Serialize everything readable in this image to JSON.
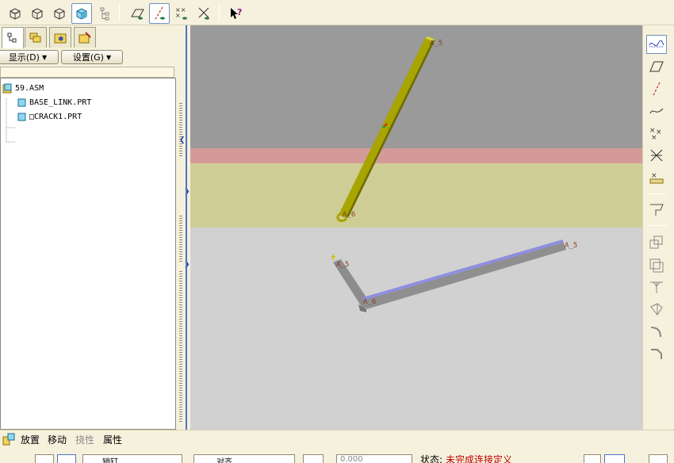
{
  "colors": {
    "app_bg": "#f5f1dc",
    "viewport_top": "#9a9a9a",
    "viewport_bottom": "#d1d1d1",
    "band_red": "#d49a9a",
    "band_yellow": "#cfcd96",
    "active_link": "#a8a400",
    "inactive_link": "#9a9a9a",
    "highlight_edge": "#8f8fe0",
    "accent_blue": "#4f72c6",
    "status_red": "#c00000"
  },
  "toolbar": {
    "icons": [
      "shaded-cube-icon",
      "hidden-line-cube-icon",
      "no-hidden-cube-icon",
      "wireframe-cube-active-icon",
      "tree-display-icon",
      "datum-plane-visibility-icon",
      "datum-axis-visibility-icon",
      "point-visibility-icon",
      "csys-visibility-icon",
      "whats-this-help-icon"
    ]
  },
  "left_panel": {
    "tabs": [
      "model-tree-tab",
      "layers-tab",
      "favorites-tab",
      "settings-tab"
    ],
    "show_button": "显示(D)",
    "settings_button": "设置(G)",
    "tree": [
      {
        "label": "59.ASM",
        "level": 0
      },
      {
        "label": "BASE_LINK.PRT",
        "level": 1
      },
      {
        "label": "□CRACK1.PRT",
        "level": 1
      }
    ]
  },
  "viewport": {
    "labels": {
      "yellow_top": "A_5",
      "yellow_bottom": "A_6",
      "gray_left": "A_5",
      "gray_joint": "A_6",
      "gray_right": "A_5"
    }
  },
  "right_toolbar": {
    "icons": [
      "sketch-curve-icon",
      "datum-plane-icon",
      "datum-axis-icon",
      "curve-icon",
      "datum-point-icon",
      "coordinate-system-icon",
      "analysis-point-icon",
      "placement-icon",
      "copy-paste-icon",
      "mirror-icon",
      "merge-icon",
      "revolve-icon",
      "round-icon",
      "chamfer-icon"
    ]
  },
  "bottom": {
    "tabs": [
      {
        "label": "放置",
        "disabled": false
      },
      {
        "label": "移动",
        "disabled": false
      },
      {
        "label": "挠性",
        "disabled": true
      },
      {
        "label": "属性",
        "disabled": false
      }
    ],
    "row2": {
      "select_label": "销钉",
      "constraint_label": "对齐",
      "offset_value": "0.000",
      "status_label": "状态:",
      "status_value": "未完成连接定义"
    }
  }
}
